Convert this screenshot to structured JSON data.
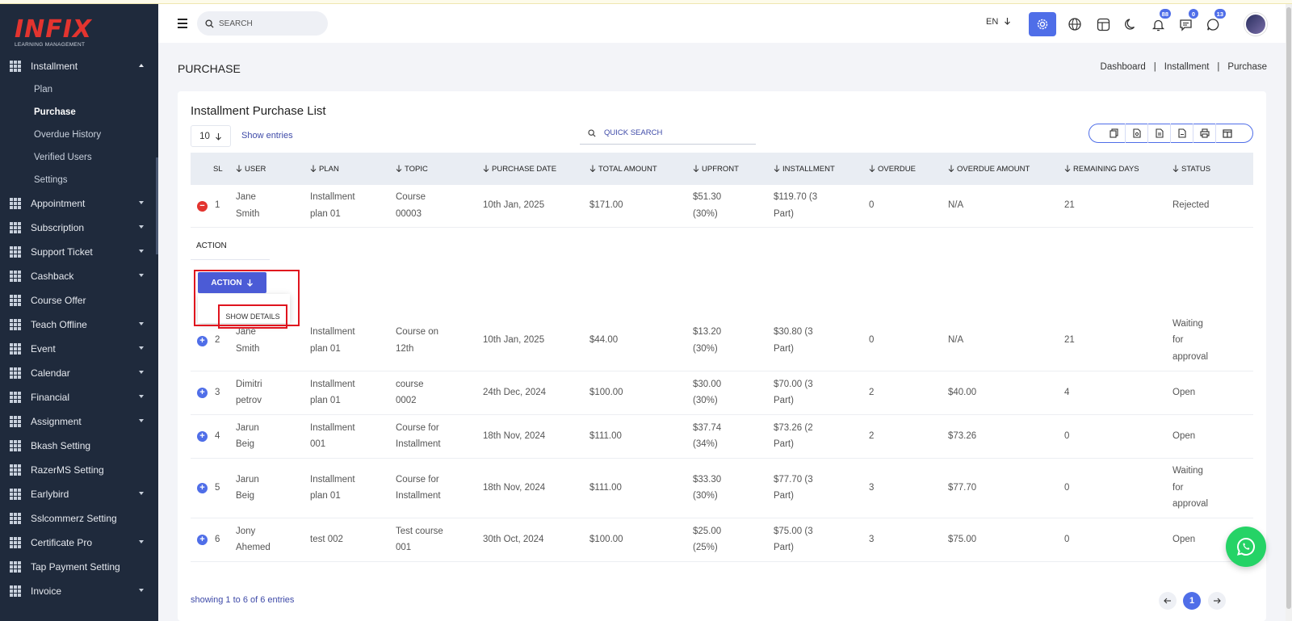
{
  "brand": {
    "name": "INFIX",
    "tagline": "LEARNING MANAGEMENT"
  },
  "header": {
    "search_placeholder": "SEARCH",
    "language": "EN",
    "badges": {
      "notifications": "88",
      "messages": "0",
      "chats": "13"
    },
    "icons": [
      "menu-icon",
      "search-icon",
      "chevron-down-icon",
      "settings-gear-icon",
      "globe-icon",
      "layout-icon",
      "moon-icon",
      "bell-icon",
      "message-icon",
      "chat-icon",
      "avatar"
    ]
  },
  "sidebar": {
    "items": [
      {
        "label": "Installment",
        "expanded": true
      },
      {
        "label": "Appointment"
      },
      {
        "label": "Subscription"
      },
      {
        "label": "Support Ticket"
      },
      {
        "label": "Cashback"
      },
      {
        "label": "Course Offer"
      },
      {
        "label": "Teach Offline"
      },
      {
        "label": "Event"
      },
      {
        "label": "Calendar"
      },
      {
        "label": "Financial"
      },
      {
        "label": "Assignment"
      },
      {
        "label": "Bkash Setting"
      },
      {
        "label": "RazerMS Setting"
      },
      {
        "label": "Earlybird"
      },
      {
        "label": "Sslcommerz Setting"
      },
      {
        "label": "Certificate Pro"
      },
      {
        "label": "Tap Payment Setting"
      },
      {
        "label": "Invoice"
      }
    ],
    "installment_sub": [
      "Plan",
      "Purchase",
      "Overdue History",
      "Verified Users",
      "Settings"
    ]
  },
  "page": {
    "title": "PURCHASE",
    "breadcrumb": [
      "Dashboard",
      "Installment",
      "Purchase"
    ],
    "breadcrumb_sep": "|"
  },
  "card": {
    "title": "Installment Purchase List",
    "entries_value": "10",
    "show_entries": "Show entries",
    "quick_search_placeholder": "QUICK SEARCH",
    "export_icons": [
      "copy-icon",
      "csv-icon",
      "excel-icon",
      "pdf-icon",
      "print-icon",
      "columns-icon"
    ]
  },
  "table": {
    "columns": [
      "SL",
      "USER",
      "PLAN",
      "TOPIC",
      "PURCHASE DATE",
      "TOTAL AMOUNT",
      "UPFRONT",
      "INSTALLMENT",
      "OVERDUE",
      "OVERDUE AMOUNT",
      "REMAINING DAYS",
      "STATUS"
    ],
    "rows": [
      {
        "sl": "1",
        "user": [
          "Jane",
          "Smith"
        ],
        "plan": [
          "Installment",
          "plan 01"
        ],
        "topic": [
          "Course",
          "00003"
        ],
        "date": "10th Jan, 2025",
        "total": "$171.00",
        "upfront": [
          "$51.30",
          "(30%)"
        ],
        "installment": [
          "$119.70 (3",
          "Part)"
        ],
        "overdue": "0",
        "overdue_amount": "N/A",
        "remaining": "21",
        "status": [
          "Rejected"
        ]
      },
      {
        "sl": "2",
        "user": [
          "Jane",
          "Smith"
        ],
        "plan": [
          "Installment",
          "plan 01"
        ],
        "topic": [
          "Course on",
          "12th"
        ],
        "date": "10th Jan, 2025",
        "total": "$44.00",
        "upfront": [
          "$13.20",
          "(30%)"
        ],
        "installment": [
          "$30.80 (3",
          "Part)"
        ],
        "overdue": "0",
        "overdue_amount": "N/A",
        "remaining": "21",
        "status": [
          "Waiting",
          "for",
          "approval"
        ]
      },
      {
        "sl": "3",
        "user": [
          "Dimitri",
          "petrov"
        ],
        "plan": [
          "Installment",
          "plan 01"
        ],
        "topic": [
          "course",
          "0002"
        ],
        "date": "24th Dec, 2024",
        "total": "$100.00",
        "upfront": [
          "$30.00",
          "(30%)"
        ],
        "installment": [
          "$70.00 (3",
          "Part)"
        ],
        "overdue": "2",
        "overdue_amount": "$40.00",
        "remaining": "4",
        "status": [
          "Open"
        ]
      },
      {
        "sl": "4",
        "user": [
          "Jarun",
          "Beig"
        ],
        "plan": [
          "Installment",
          "001"
        ],
        "topic": [
          "Course for",
          "Installment"
        ],
        "date": "18th Nov, 2024",
        "total": "$111.00",
        "upfront": [
          "$37.74",
          "(34%)"
        ],
        "installment": [
          "$73.26 (2",
          "Part)"
        ],
        "overdue": "2",
        "overdue_amount": "$73.26",
        "remaining": "0",
        "status": [
          "Open"
        ]
      },
      {
        "sl": "5",
        "user": [
          "Jarun",
          "Beig"
        ],
        "plan": [
          "Installment",
          "plan 01"
        ],
        "topic": [
          "Course for",
          "Installment"
        ],
        "date": "18th Nov, 2024",
        "total": "$111.00",
        "upfront": [
          "$33.30",
          "(30%)"
        ],
        "installment": [
          "$77.70 (3",
          "Part)"
        ],
        "overdue": "3",
        "overdue_amount": "$77.70",
        "remaining": "0",
        "status": [
          "Waiting",
          "for",
          "approval"
        ]
      },
      {
        "sl": "6",
        "user": [
          "Jony",
          "Ahemed"
        ],
        "plan": [
          "test 002"
        ],
        "topic": [
          "Test course",
          "001"
        ],
        "date": "30th Oct, 2024",
        "total": "$100.00",
        "upfront": [
          "$25.00",
          "(25%)"
        ],
        "installment": [
          "$75.00 (3",
          "Part)"
        ],
        "overdue": "3",
        "overdue_amount": "$75.00",
        "remaining": "0",
        "status": [
          "Open"
        ]
      }
    ],
    "expanded_row": {
      "action_label": "ACTION",
      "action_button": "ACTION",
      "show_details": "SHOW DETAILS"
    }
  },
  "footer": {
    "info": "showing 1 to 6 of 6 entries",
    "page": "1"
  },
  "colors": {
    "sidebar_bg": "#1f2a3c",
    "accent": "#4f6ee8",
    "danger": "#e3342f",
    "whatsapp": "#25d366"
  }
}
